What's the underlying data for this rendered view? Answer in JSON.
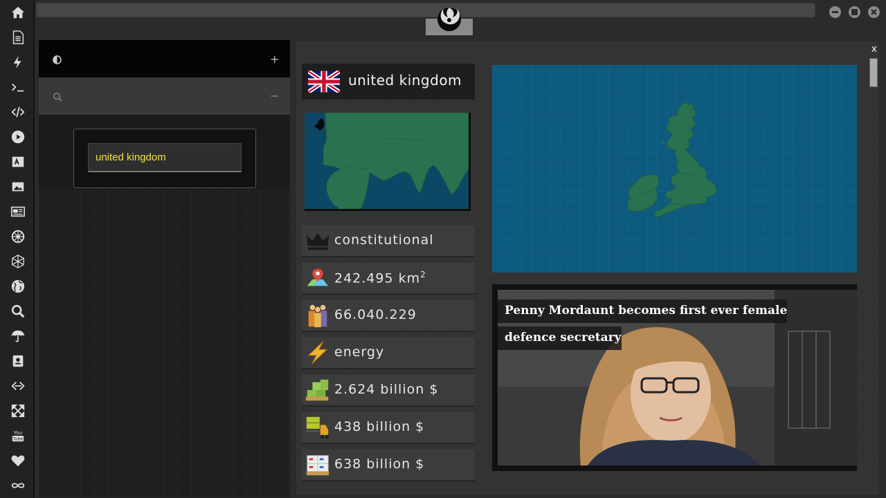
{
  "app": {
    "address_bar": ""
  },
  "sidebar": {
    "icons": [
      "home-icon",
      "document-icon",
      "bolt-icon",
      "terminal-icon",
      "code-icon",
      "play-icon",
      "translate-icon",
      "image-icon",
      "newspaper-icon",
      "empire-icon",
      "rebel-hex-icon",
      "globe-icon",
      "search-icon",
      "umbrella-icon",
      "contacts-icon",
      "embed-icon",
      "expand-icon",
      "youtube-icon",
      "heart-icon",
      "infinity-icon"
    ]
  },
  "left_panel": {
    "theme_icon": "contrast-icon",
    "add_symbol": "+",
    "search_icon": "search-icon",
    "collapse_symbol": "−",
    "search_value": "united kingdom"
  },
  "main": {
    "close_label": "x",
    "country": {
      "name": "united kingdom",
      "flag": "uk-flag",
      "government": "constitutional",
      "area_value": "242.495 km",
      "area_sup": "2",
      "population": "66.040.229",
      "sector": "energy",
      "gdp": "2.624 billion $",
      "imports": "438 billion $",
      "exports": "638 billion $"
    },
    "news": {
      "headline": "Penny Mordaunt becomes first ever female defence secretary"
    }
  },
  "colors": {
    "map_sea": "#0c5a7e",
    "map_land": "#2a7150",
    "accent_text": "#f2e24a"
  }
}
